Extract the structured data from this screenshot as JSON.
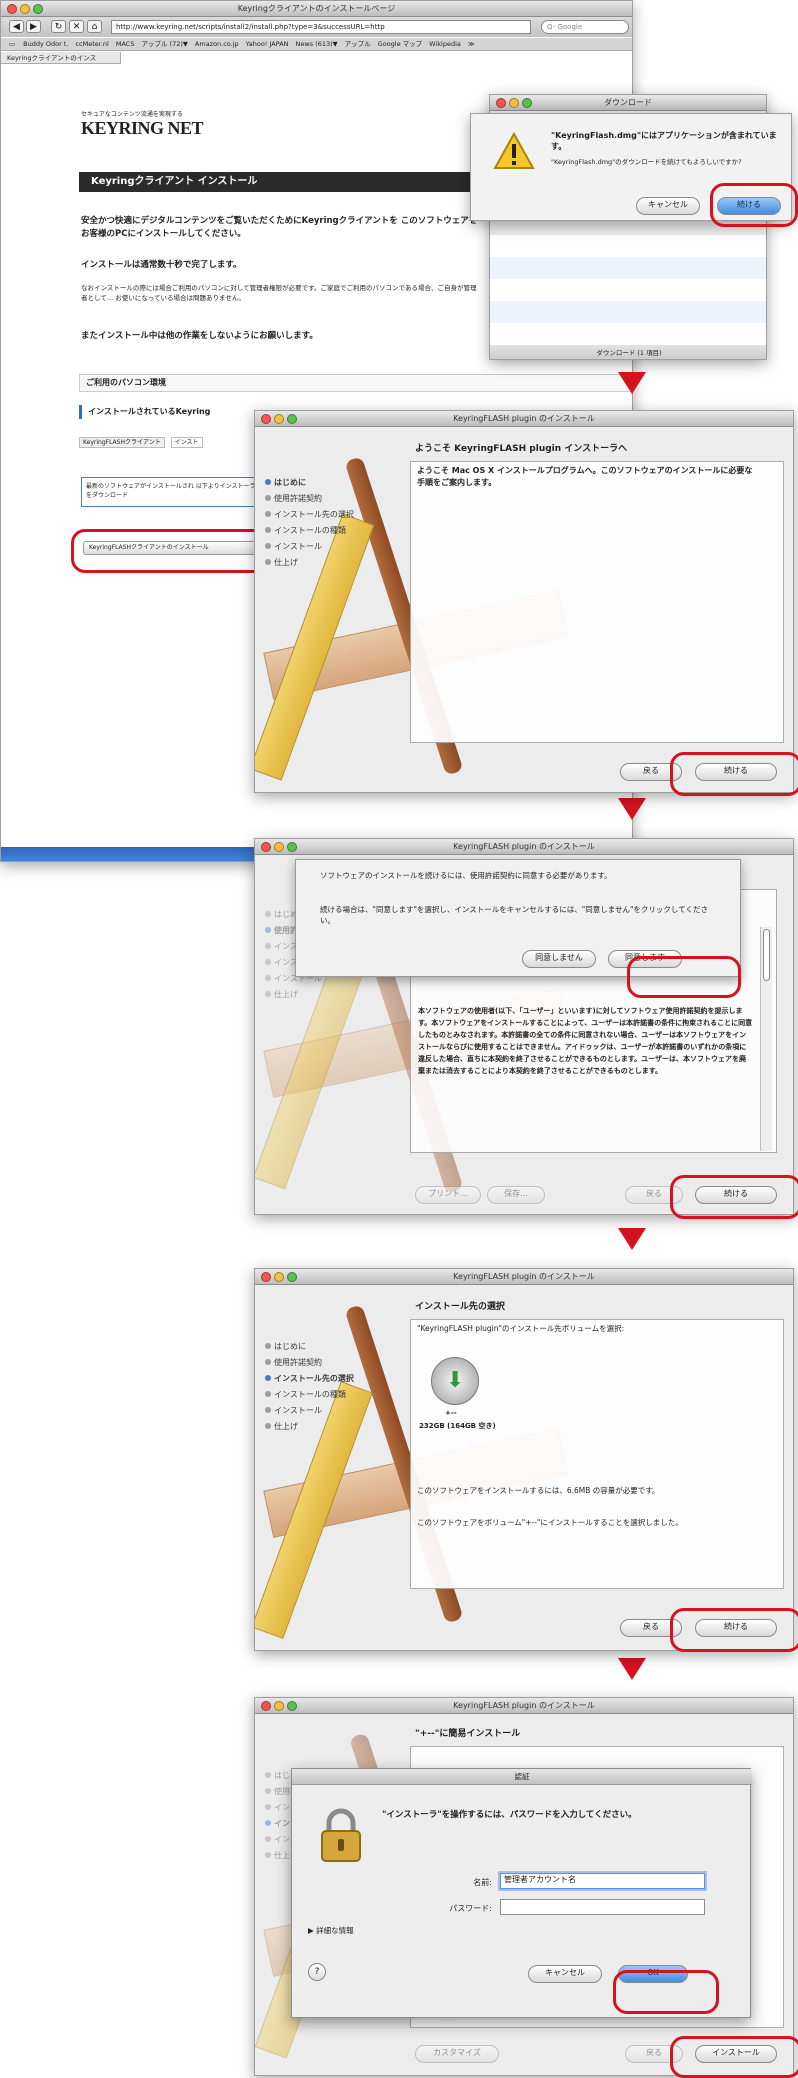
{
  "colors": {
    "accent_red": "#d6121f",
    "button_blue": "#3f8ee3"
  },
  "browser": {
    "title": "Keyringクライアントのインストールページ",
    "url": "http://www.keyring.net/scripts/install2/install.php?type=3&successURL=http",
    "search_placeholder": "Q- Google",
    "bookmarks": [
      "Buddy Odor t.",
      "ccMeter.nl",
      "MACS",
      "アップル (72)▼",
      "Amazon.co.jp",
      "Yahoo! JAPAN",
      "News (613)▼",
      "アップル",
      "Google マップ",
      "Wikipedia",
      "≫"
    ],
    "tab": "Keyringクライアントのインス",
    "logo_tagline": "セキュアなコンテンツ流通を実現する",
    "logo_text": "KEYRING NET",
    "banner": "Keyringクライアント インストール",
    "para1": "安全かつ快適にデジタルコンテンツをご覧いただくためにKeyringクライアントを このソフトウェアをお客様のPCにインストールしてください。",
    "para2": "インストールは通常数十秒で完了します。",
    "para3": "なおインストールの際には場合ご利用のパソコンに対して管理者権限が必要です。ご家庭でご利用のパソコンである場合、ご自身が管理者として… お使いになっている場合は問題ありません。",
    "para4": "またインストール中は他の作業をしないようにお願いします。",
    "section": "ご利用のパソコン環境",
    "installed_label": "インストールされているKeyring",
    "row_label": "KeyringFLASHクライアント",
    "row_value": "インスト",
    "notice": "最新のソフトウェアがインストールされ 以下よりインストーラをダウンロード",
    "install_link": "KeyringFLASHクライアントのインストール"
  },
  "download": {
    "title": "ダウンロード",
    "alert_title": "\"KeyringFlash.dmg\"にはアプリケーションが含まれています。",
    "alert_body": "\"KeyringFlash.dmg\"のダウンロードを続けてもよろしいですか?",
    "cancel": "キャンセル",
    "continue": "続ける",
    "footer": "ダウンロード (1 項目)"
  },
  "installer_title": "KeyringFLASH plugin のインストール",
  "steps": [
    "はじめに",
    "使用許諾契約",
    "インストール先の選択",
    "インストールの種類",
    "インストール",
    "仕上げ"
  ],
  "win1": {
    "heading": "ようこそ KeyringFLASH plugin インストーラへ",
    "body": "ようこそ Mac OS X インストールプログラムへ。このソフトウェアのインストールに必要な手順をご案内します。",
    "back": "戻る",
    "continue": "続ける"
  },
  "win2": {
    "sheet_text1": "ソフトウェアのインストールを続けるには、使用許諾契約に同意する必要があります。",
    "sheet_text2": "続ける場合は、\"同意します\"を選択し、インストールをキャンセルするには、\"同意しません\"をクリックしてください。",
    "disagree": "同意しません",
    "agree": "同意します",
    "license_text": "本ソフトウェアの使用者(以下、「ユーザー」といいます)に対してソフトウェア使用許諾契約を提示します。本ソフトウェアをインストールすることによって、ユーザーは本許諾書の条件に拘束されることに同意したものとみなされます。本許諾書の全ての条件に同意されない場合、ユーザーは本ソフトウェアをインストールならびに使用することはできません。アイドゥックは、ユーザーが本許諾書のいずれかの条項に違反した場合、直ちに本契約を終了させることができるものとします。ユーザーは、本ソフトウェアを廃棄または消去することにより本契約を終了させることができるものとします。",
    "print": "プリント...",
    "save": "保存...",
    "back": "戻る",
    "continue": "続ける"
  },
  "win3": {
    "heading": "インストール先の選択",
    "prompt": "\"KeyringFLASH plugin\"のインストール先ボリュームを選択:",
    "disk_name": "+--",
    "disk_size": "232GB (164GB 空き)",
    "info1": "このソフトウェアをインストールするには、6.6MB の容量が必要です。",
    "info2": "このソフトウェアをボリューム\"+--\"にインストールすることを選択しました。",
    "back": "戻る",
    "continue": "続ける"
  },
  "win4": {
    "heading": "\"+--\"に簡易インストール",
    "auth_title": "認証",
    "auth_message": "\"インストーラ\"を操作するには、パスワードを入力してください。",
    "name_label": "名前:",
    "name_value": "管理者アカウント名",
    "password_label": "パスワード:",
    "details": "詳細な情報",
    "help": "?",
    "cancel": "キャンセル",
    "ok": "OK",
    "customize": "カスタマイズ",
    "back": "戻る",
    "install": "インストール"
  }
}
